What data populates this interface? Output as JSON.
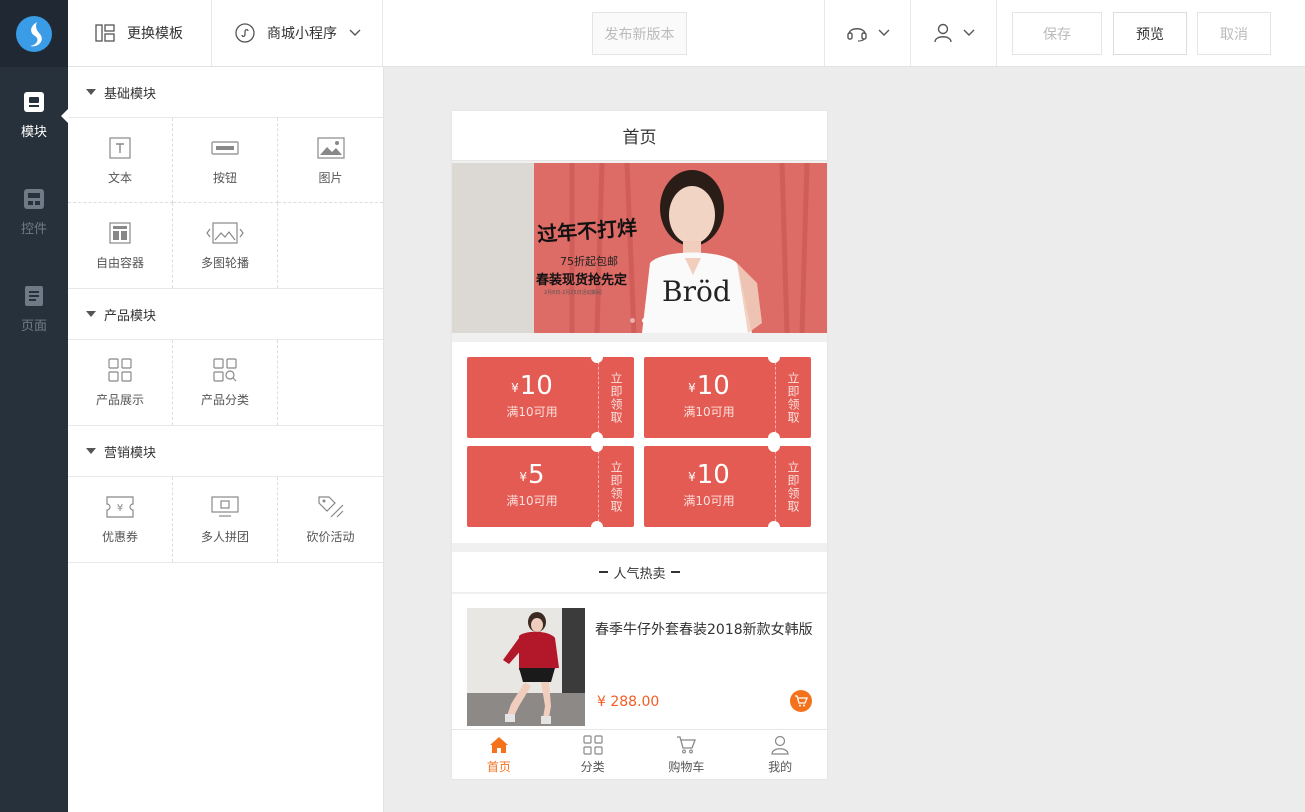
{
  "nav": {
    "items": [
      {
        "label": "模块",
        "icon": "module-icon",
        "active": true
      },
      {
        "label": "控件",
        "icon": "widget-icon",
        "active": false
      },
      {
        "label": "页面",
        "icon": "page-icon",
        "active": false
      }
    ]
  },
  "topbar": {
    "template_label": "更换模板",
    "app_label": "商城小程序",
    "publish_label": "发布新版本",
    "save_label": "保存",
    "preview_label": "预览",
    "cancel_label": "取消"
  },
  "panel": {
    "sections": [
      {
        "title": "基础模块",
        "items": [
          {
            "label": "文本",
            "icon": "text-icon"
          },
          {
            "label": "按钮",
            "icon": "button-icon"
          },
          {
            "label": "图片",
            "icon": "image-icon"
          },
          {
            "label": "自由容器",
            "icon": "container-icon"
          },
          {
            "label": "多图轮播",
            "icon": "carousel-icon"
          }
        ]
      },
      {
        "title": "产品模块",
        "items": [
          {
            "label": "产品展示",
            "icon": "product-grid-icon"
          },
          {
            "label": "产品分类",
            "icon": "product-category-icon"
          }
        ]
      },
      {
        "title": "营销模块",
        "items": [
          {
            "label": "优惠券",
            "icon": "coupon-icon"
          },
          {
            "label": "多人拼团",
            "icon": "group-buy-icon"
          },
          {
            "label": "砍价活动",
            "icon": "bargain-icon"
          }
        ]
      }
    ]
  },
  "phone": {
    "title": "首页",
    "banner": {
      "headline": "过年不打烊",
      "subline": "75折起包邮",
      "tagline": "春装现货抢先定",
      "small": "2月8日-2月25日活动期间",
      "brand": "Bröd"
    },
    "coupons": [
      {
        "currency": "¥",
        "amount": "10",
        "condition": "满10可用",
        "action": "立即领取"
      },
      {
        "currency": "¥",
        "amount": "10",
        "condition": "满10可用",
        "action": "立即领取"
      },
      {
        "currency": "¥",
        "amount": "5",
        "condition": "满10可用",
        "action": "立即领取"
      },
      {
        "currency": "¥",
        "amount": "10",
        "condition": "满10可用",
        "action": "立即领取"
      }
    ],
    "hot_title": "人气热卖",
    "product": {
      "name": "春季牛仔外套春装2018新款女韩版",
      "price": "¥ 288.00"
    },
    "tabs": [
      {
        "label": "首页",
        "icon": "home-icon",
        "active": true
      },
      {
        "label": "分类",
        "icon": "category-icon",
        "active": false
      },
      {
        "label": "购物车",
        "icon": "cart-icon",
        "active": false
      },
      {
        "label": "我的",
        "icon": "user-icon",
        "active": false
      }
    ]
  },
  "colors": {
    "accent": "#f5721d",
    "coupon": "#e35b52",
    "sidebar": "#27313b"
  }
}
